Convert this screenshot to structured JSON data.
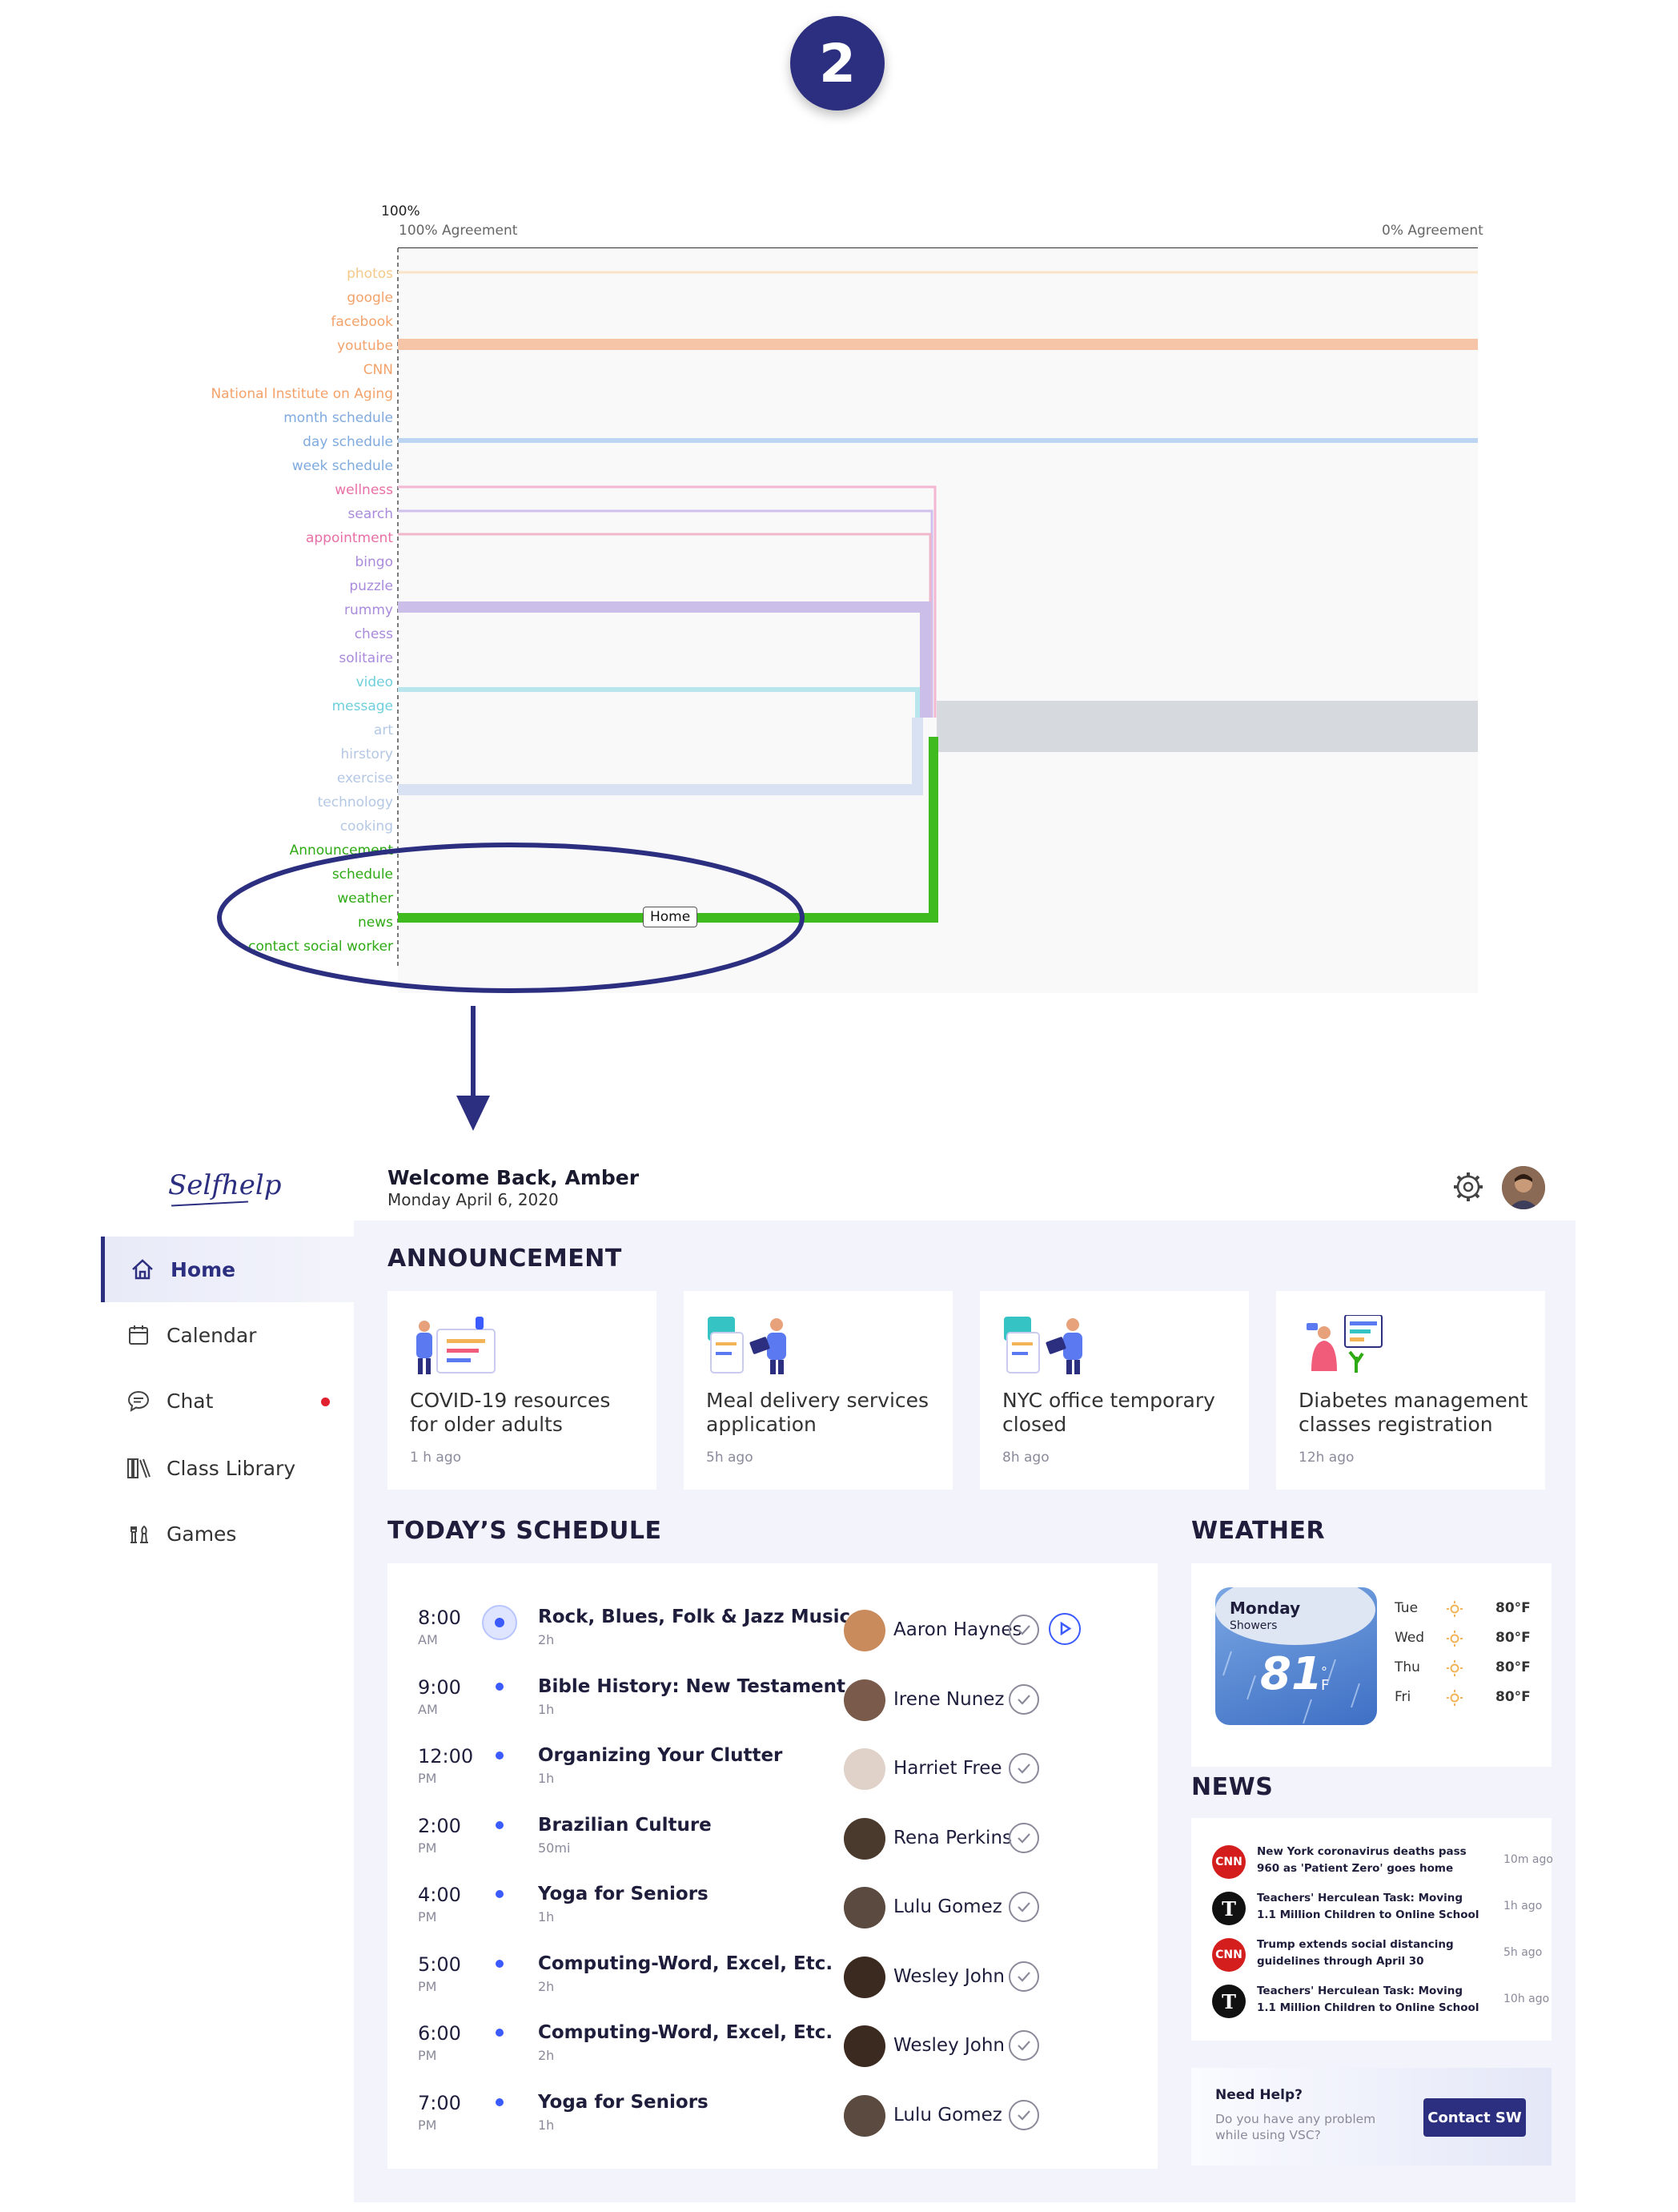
{
  "step_badge": "2",
  "dendrogram": {
    "top_pct": "100%",
    "left_caption": "100% Agreement",
    "right_caption": "0% Agreement",
    "labels": [
      {
        "text": "photos",
        "color": "#f4c98a"
      },
      {
        "text": "google",
        "color": "#f4a26a"
      },
      {
        "text": "facebook",
        "color": "#f4a26a"
      },
      {
        "text": "youtube",
        "color": "#f4a26a"
      },
      {
        "text": "CNN",
        "color": "#f4a26a"
      },
      {
        "text": "National Institute on Aging",
        "color": "#f4a26a"
      },
      {
        "text": "month schedule",
        "color": "#7faadf"
      },
      {
        "text": "day schedule",
        "color": "#7faadf"
      },
      {
        "text": "week schedule",
        "color": "#7faadf"
      },
      {
        "text": "wellness",
        "color": "#e86fa5"
      },
      {
        "text": "search",
        "color": "#a98adc"
      },
      {
        "text": "appointment",
        "color": "#e86fa5"
      },
      {
        "text": "bingo",
        "color": "#a98adc"
      },
      {
        "text": "puzzle",
        "color": "#a98adc"
      },
      {
        "text": "rummy",
        "color": "#a98adc"
      },
      {
        "text": "chess",
        "color": "#a98adc"
      },
      {
        "text": "solitaire",
        "color": "#a98adc"
      },
      {
        "text": "video",
        "color": "#6fcfdc"
      },
      {
        "text": "message",
        "color": "#6fcfdc"
      },
      {
        "text": "art",
        "color": "#b4c8e4"
      },
      {
        "text": "hirstory",
        "color": "#b4c8e4"
      },
      {
        "text": "exercise",
        "color": "#b4c8e4"
      },
      {
        "text": "technology",
        "color": "#b4c8e4"
      },
      {
        "text": "cooking",
        "color": "#b4c8e4"
      },
      {
        "text": "Announcement",
        "color": "#2eaa14"
      },
      {
        "text": "schedule",
        "color": "#2eaa14"
      },
      {
        "text": "weather",
        "color": "#2eaa14"
      },
      {
        "text": "news",
        "color": "#2eaa14"
      },
      {
        "text": "contact social worker",
        "color": "#2eaa14"
      }
    ],
    "home_tag": "Home"
  },
  "app": {
    "logo": "Selfhelp",
    "welcome": "Welcome Back, Amber",
    "date": "Monday April 6, 2020",
    "nav": [
      {
        "label": "Home",
        "icon": "home-icon",
        "active": true
      },
      {
        "label": "Calendar",
        "icon": "calendar-icon",
        "active": false
      },
      {
        "label": "Chat",
        "icon": "chat-icon",
        "active": false
      },
      {
        "label": "Class Library",
        "icon": "library-icon",
        "active": false
      },
      {
        "label": "Games",
        "icon": "games-icon",
        "active": false
      }
    ],
    "announcement": {
      "heading": "ANNOUNCEMENT",
      "cards": [
        {
          "title": "COVID-19 resources for older adults",
          "time": "1 h ago"
        },
        {
          "title": "Meal delivery services application",
          "time": "5h ago"
        },
        {
          "title": "NYC office temporary closed",
          "time": "8h ago"
        },
        {
          "title": "Diabetes management classes registration",
          "time": "12h ago"
        }
      ]
    },
    "schedule": {
      "heading": "TODAY’S SCHEDULE",
      "rows": [
        {
          "time": "8:00",
          "ampm": "AM",
          "title": "Rock, Blues, Folk & Jazz Music",
          "dur": "2h",
          "person": "Aaron Haynes",
          "current": true
        },
        {
          "time": "9:00",
          "ampm": "AM",
          "title": "Bible History: New Testament",
          "dur": "1h",
          "person": "Irene Nunez"
        },
        {
          "time": "12:00",
          "ampm": "PM",
          "title": "Organizing Your Clutter",
          "dur": "1h",
          "person": "Harriet Free"
        },
        {
          "time": "2:00",
          "ampm": "PM",
          "title": "Brazilian Culture",
          "dur": "50mi",
          "person": "Rena Perkins"
        },
        {
          "time": "4:00",
          "ampm": "PM",
          "title": "Yoga for Seniors",
          "dur": "1h",
          "person": "Lulu Gomez"
        },
        {
          "time": "5:00",
          "ampm": "PM",
          "title": "Computing-Word, Excel, Etc.",
          "dur": "2h",
          "person": "Wesley John"
        },
        {
          "time": "6:00",
          "ampm": "PM",
          "title": "Computing-Word, Excel, Etc.",
          "dur": "2h",
          "person": "Wesley John"
        },
        {
          "time": "7:00",
          "ampm": "PM",
          "title": "Yoga for Seniors",
          "dur": "1h",
          "person": "Lulu Gomez"
        }
      ]
    },
    "weather": {
      "heading": "WEATHER",
      "day": "Monday",
      "cond": "Showers",
      "temp": "81",
      "deg": "°",
      "unit": "F",
      "forecast": [
        {
          "day": "Tue",
          "temp": "80°F"
        },
        {
          "day": "Wed",
          "temp": "80°F"
        },
        {
          "day": "Thu",
          "temp": "80°F"
        },
        {
          "day": "Fri",
          "temp": "80°F"
        }
      ]
    },
    "news": {
      "heading": "NEWS",
      "items": [
        {
          "source": "CNN",
          "text": "New York coronavirus deaths pass 960 as 'Patient Zero' goes home",
          "time": "10m ago"
        },
        {
          "source": "NYT",
          "text": "Teachers' Herculean Task: Moving 1.1 Million Children to Online School",
          "time": "1h ago"
        },
        {
          "source": "CNN",
          "text": "Trump extends social distancing guidelines through April 30",
          "time": "5h ago"
        },
        {
          "source": "NYT",
          "text": "Teachers' Herculean Task: Moving 1.1 Million Children to Online School",
          "time": "10h ago"
        }
      ]
    },
    "help": {
      "title": "Need Help?",
      "text": "Do you have any problem while using VSC?",
      "button": "Contact SW"
    },
    "colors": {
      "brand": "#2c2f80",
      "accent": "#3b5bff",
      "bg": "#f3f4fb",
      "alert": "#e01f2f"
    }
  }
}
